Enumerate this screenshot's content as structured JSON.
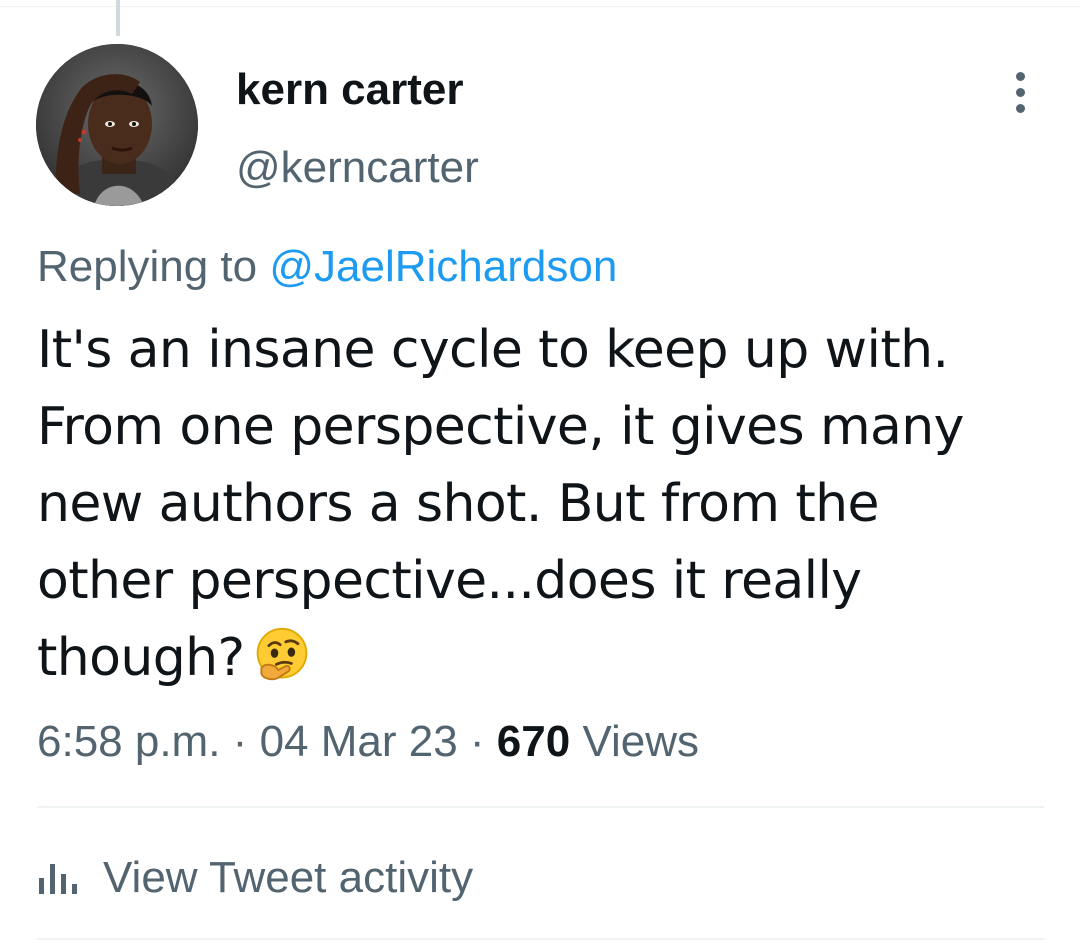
{
  "author": {
    "display_name": "kern carter",
    "handle": "@kerncarter"
  },
  "reply": {
    "prefix": "Replying to ",
    "mention": "@JaelRichardson"
  },
  "tweet": {
    "text": "It's an insane cycle to keep up with.\nFrom one perspective, it gives many\nnew authors a shot. But from the\nother perspective...does it really\nthough?",
    "emoji": "thinking-face-emoji"
  },
  "meta": {
    "time": "6:58 p.m.",
    "separator": "·",
    "date": "04 Mar 23",
    "views_count": "670",
    "views_label": "Views"
  },
  "activity": {
    "label": "View Tweet activity",
    "icon": "bar-chart-icon"
  },
  "menu": {
    "icon": "more-vertical-icon"
  },
  "colors": {
    "text_primary": "#0f1419",
    "text_secondary": "#536471",
    "accent": "#1d9bf0",
    "divider": "#eff3f4"
  }
}
